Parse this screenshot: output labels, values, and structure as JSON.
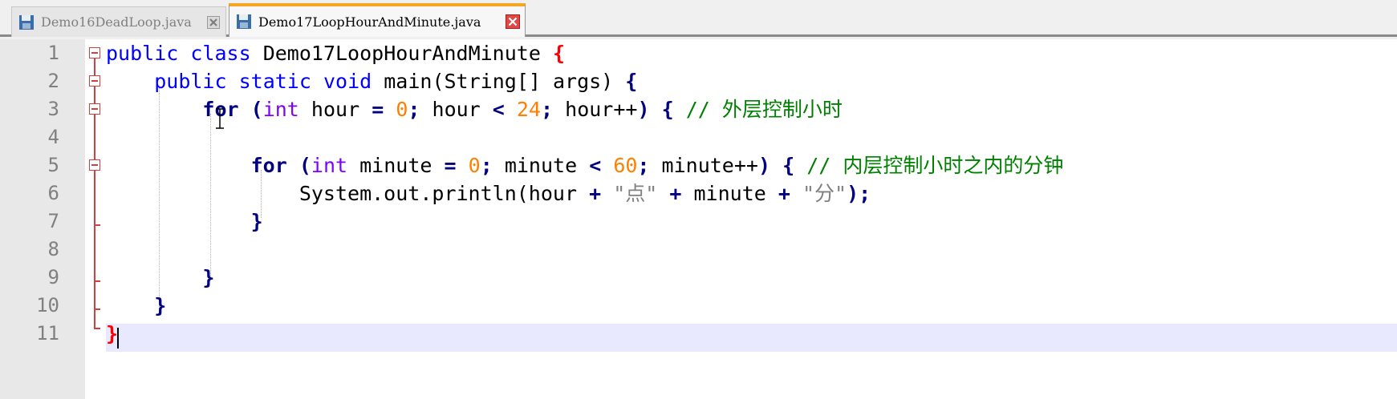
{
  "tabs": [
    {
      "label": "Demo16DeadLoop.java",
      "active": false
    },
    {
      "label": "Demo17LoopHourAndMinute.java",
      "active": true
    }
  ],
  "line_numbers": [
    "1",
    "2",
    "3",
    "4",
    "5",
    "6",
    "7",
    "8",
    "9",
    "10",
    "11"
  ],
  "code": {
    "l1": {
      "kw1": "public",
      "kw2": "class",
      "name": "Demo17LoopHourAndMinute",
      "brace": "{"
    },
    "l2": {
      "kw1": "public",
      "kw2": "static",
      "kw3": "void",
      "rest": "main(String[] args)",
      "brace": "{"
    },
    "l3": {
      "kw": "for",
      "p1": "(",
      "type": "int",
      "v1": "hour",
      "eq": "=",
      "n1": "0",
      "s1": ";",
      "v2": "hour",
      "lt": "<",
      "n2": "24",
      "s2": ";",
      "v3": "hour++",
      "p2": ")",
      "brace": "{",
      "comment": "// 外层控制小时"
    },
    "l5": {
      "kw": "for",
      "p1": "(",
      "type": "int",
      "v1": "minute",
      "eq": "=",
      "n1": "0",
      "s1": ";",
      "v2": "minute",
      "lt": "<",
      "n2": "60",
      "s2": ";",
      "v3": "minute++",
      "p2": ")",
      "brace": "{",
      "comment": "// 内层控制小时之内的分钟"
    },
    "l6": {
      "a": "System.out.println(hour",
      "plus1": "+",
      "str1": "\"点\"",
      "plus2": "+",
      "b": "minute",
      "plus3": "+",
      "str2": "\"分\"",
      "c": ");"
    },
    "l7": {
      "brace": "}"
    },
    "l9": {
      "brace": "}"
    },
    "l10": {
      "brace": "}"
    },
    "l11": {
      "brace": "}"
    }
  },
  "colors": {
    "accent_tab": "#f5a623",
    "keyword": "#0000ff",
    "number": "#ff8000",
    "comment": "#008000",
    "fold": "#d04040"
  }
}
